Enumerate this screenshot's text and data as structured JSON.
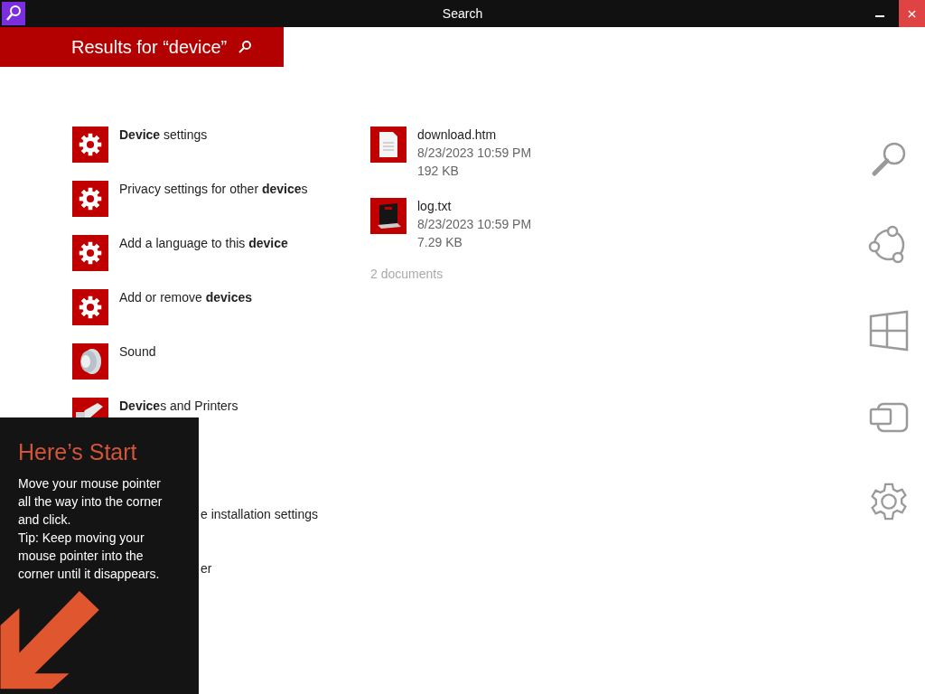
{
  "window": {
    "title": "Search"
  },
  "header": {
    "title": "Results for “device”"
  },
  "results": [
    {
      "kind": "setting",
      "text": "**Device** settings"
    },
    {
      "kind": "setting",
      "text": "Privacy settings for other **device**s"
    },
    {
      "kind": "setting",
      "text": "Add a language to this **device**"
    },
    {
      "kind": "setting",
      "text": "Add or remove **devices**"
    },
    {
      "kind": "sound",
      "text": "Sound"
    },
    {
      "kind": "printer",
      "text": "**Device**s and Printers"
    },
    {
      "kind": "partial"
    },
    {
      "kind": "partial",
      "text": "e installation settings"
    },
    {
      "kind": "partial",
      "text": "er"
    }
  ],
  "files": [
    {
      "kind": "htm",
      "name": "download.htm",
      "date": "8/23/2023 10:59 PM",
      "size": "192 KB"
    },
    {
      "kind": "txt",
      "name": "log.txt",
      "date": "8/23/2023 10:59 PM",
      "size": "7.29 KB"
    }
  ],
  "files_count": "2 documents",
  "tip": {
    "title": "Here’s Start",
    "body": "Move your mouse pointer all the way into the corner and click.",
    "tip": "Tip: Keep moving your mouse pointer into the corner until it disappears."
  }
}
